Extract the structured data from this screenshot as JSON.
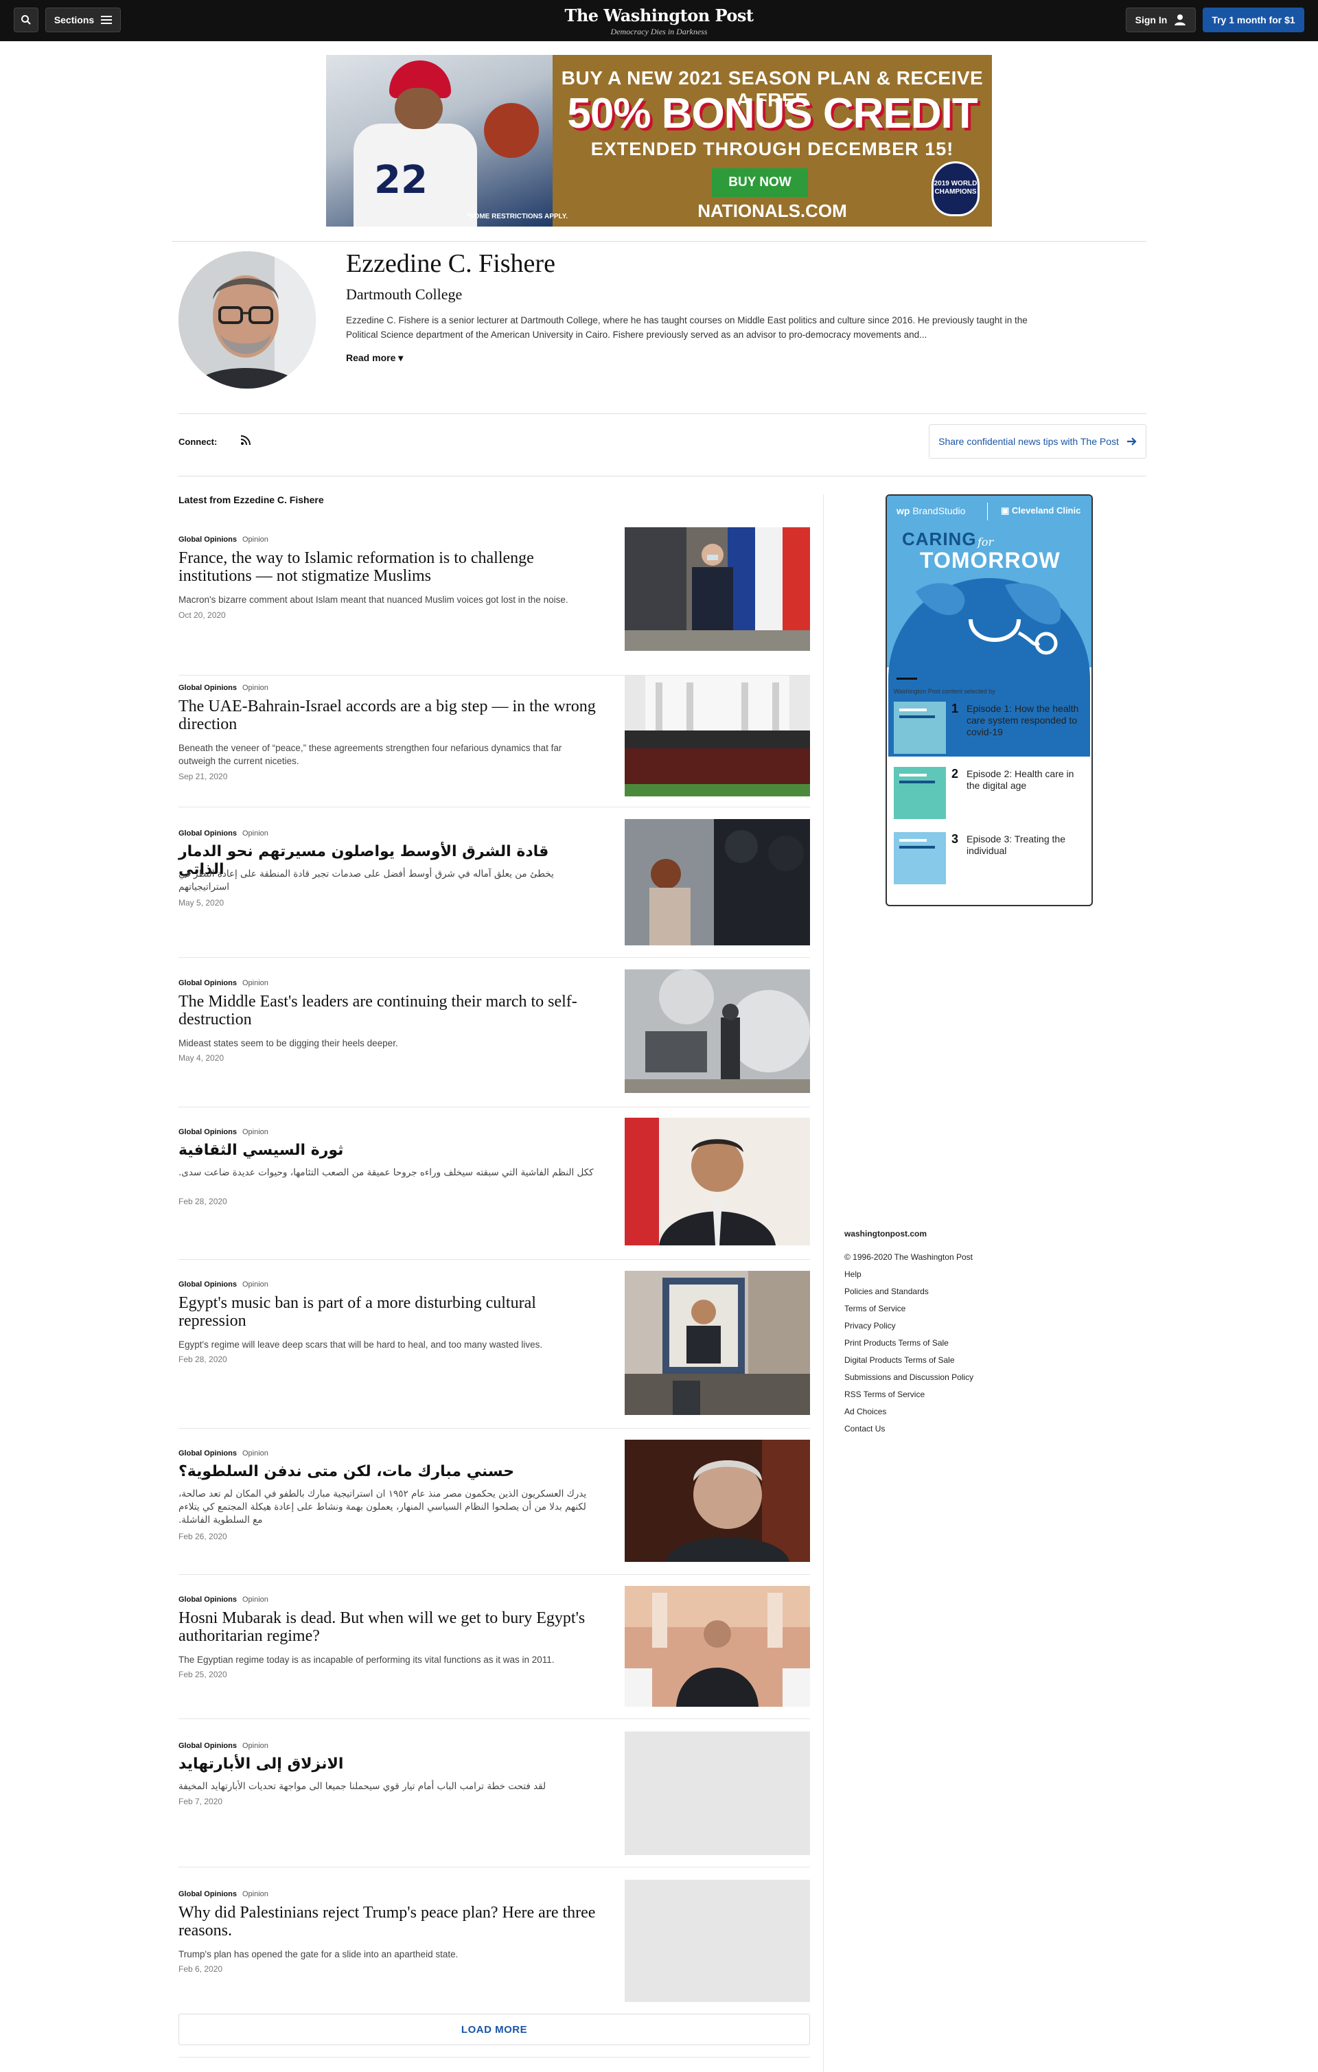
{
  "nav": {
    "sections_label": "Sections",
    "masthead_title": "The Washington Post",
    "masthead_tagline": "Democracy Dies in Darkness",
    "signin_label": "Sign In",
    "trial_label": "Try 1 month for $1"
  },
  "ad": {
    "line1": "BUY A NEW 2021 SEASON PLAN & RECEIVE A FREE",
    "line2": "50% BONUS CREDIT",
    "line3": "EXTENDED THROUGH DECEMBER 15!",
    "cta": "BUY NOW",
    "fine_print": "*SOME RESTRICTIONS APPLY.",
    "site": "NATIONALS.COM",
    "badge": "2019 WORLD CHAMPIONS",
    "jersey_number": "22"
  },
  "author": {
    "name": "Ezzedine C. Fishere",
    "org": "Dartmouth College",
    "bio": "Ezzedine C. Fishere is a senior lecturer at Dartmouth College, where he has taught courses on Middle East politics and culture since 2016. He previously taught in the Political Science department of the American University in Cairo. Fishere previously served as an advisor to pro-democracy movements and...",
    "read_more": "Read more"
  },
  "connect": {
    "label": "Connect:",
    "tips": "Share confidential news tips with The Post"
  },
  "feed": {
    "heading": "Latest from Ezzedine C. Fishere",
    "items": [
      {
        "section": "Global Opinions",
        "type": "Opinion",
        "headline": "France, the way to Islamic reformation is to challenge institutions — not stigmatize Muslims",
        "blurb": "Macron's bizarre comment about Islam meant that nuanced Muslim voices got lost in the noise.",
        "date": "Oct 20, 2020"
      },
      {
        "section": "Global Opinions",
        "type": "Opinion",
        "headline": "The UAE-Bahrain-Israel accords are a big step — in the wrong direction",
        "blurb": "Beneath the veneer of “peace,” these agreements strengthen four nefarious dynamics that far outweigh the current niceties.",
        "date": "Sep 21, 2020"
      },
      {
        "section": "Global Opinions",
        "type": "Opinion",
        "headline": "قادة الشرق الأوسط يواصلون مسيرتهم نحو الدمار الذاتي",
        "blurb": "يخطئ من يعلق آماله في شرق أوسط أفضل على صدمات تجبر قادة المنطقة على إعادة النظر في استراتيجياتهم",
        "date": "May 5, 2020"
      },
      {
        "section": "Global Opinions",
        "type": "Opinion",
        "headline": "The Middle East's leaders are continuing their march to self-destruction",
        "blurb": "Mideast states seem to be digging their heels deeper.",
        "date": "May 4, 2020"
      },
      {
        "section": "Global Opinions",
        "type": "Opinion",
        "headline": "ثورة السيسي الثقافية",
        "blurb": "ككل النظم الفاشية التي سبقته سيخلف وراءه جروحا عميقة من الصعب التئامها، وحيوات عديدة ضاعت سدى.",
        "date": "Feb 28, 2020"
      },
      {
        "section": "Global Opinions",
        "type": "Opinion",
        "headline": "Egypt's music ban is part of a more disturbing cultural repression",
        "blurb": "Egypt's regime will leave deep scars that will be hard to heal, and too many wasted lives.",
        "date": "Feb 28, 2020"
      },
      {
        "section": "Global Opinions",
        "type": "Opinion",
        "headline": "حسني مبارك مات، لكن متى ندفن السلطوية؟",
        "blurb": "يدرك العسكريون الذين يحكمون مصر منذ عام ١٩٥٢ ان استراتيجية مبارك بالطفو في المكان لم تعد صالحة، لكنهم بدلا من أن يصلحوا النظام السياسي المنهار، يعملون بهمة ونشاط على إعادة هيكلة المجتمع كي يتلاءم مع السلطوية الفاشلة.",
        "date": "Feb 26, 2020"
      },
      {
        "section": "Global Opinions",
        "type": "Opinion",
        "headline": "Hosni Mubarak is dead. But when will we get to bury Egypt's authoritarian regime?",
        "blurb": "The Egyptian regime today is as incapable of performing its vital functions as it was in 2011.",
        "date": "Feb 25, 2020"
      },
      {
        "section": "Global Opinions",
        "type": "Opinion",
        "headline": "الانزلاق إلى الأبارتهايد",
        "blurb": "لقد فتحت خطة ترامب الباب أمام تيار قوي سيحملنا جميعا الى مواجهة تحديات الأبارتهايد المخيفة",
        "date": "Feb 7, 2020"
      },
      {
        "section": "Global Opinions",
        "type": "Opinion",
        "headline": "Why did Palestinians reject Trump's peace plan? Here are three reasons.",
        "blurb": "Trump's plan has opened the gate for a slide into an apartheid state.",
        "date": "Feb 6, 2020"
      }
    ],
    "load_more": "LOAD MORE"
  },
  "brand": {
    "studio": "BrandStudio",
    "studio_prefix": "wp",
    "partner": "Cleveland Clinic",
    "caring": "CARING",
    "for": "for",
    "tomorrow": "TOMORROW",
    "selected_by": "Washington Post content selected by",
    "episodes": [
      {
        "num": "1",
        "title": "Episode 1: How the health care system responded to covid-19"
      },
      {
        "num": "2",
        "title": "Episode 2: Health care in the digital age"
      },
      {
        "num": "3",
        "title": "Episode 3: Treating the individual"
      }
    ]
  },
  "footer": {
    "site": "washingtonpost.com",
    "links": [
      "© 1996-2020 The Washington Post",
      "Help",
      "Policies and Standards",
      "Terms of Service",
      "Privacy Policy",
      "Print Products Terms of Sale",
      "Digital Products Terms of Sale",
      "Submissions and Discussion Policy",
      "RSS Terms of Service",
      "Ad Choices",
      "Contact Us"
    ]
  }
}
